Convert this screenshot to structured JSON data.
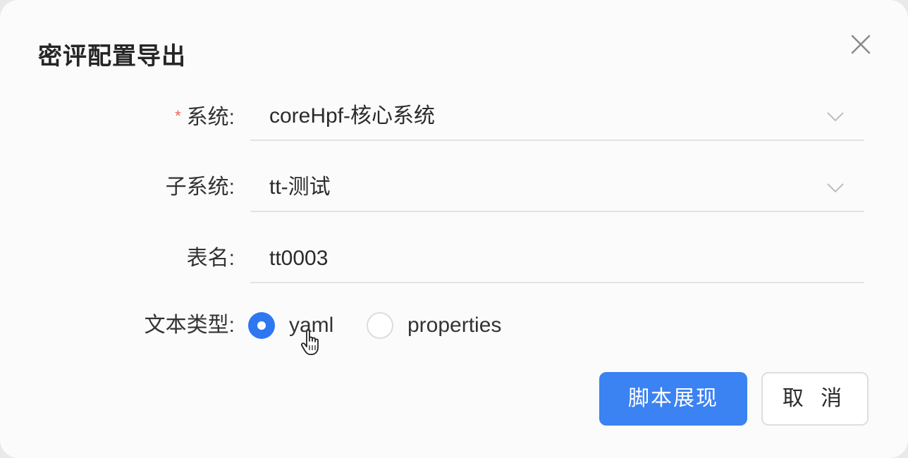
{
  "dialog": {
    "title": "密评配置导出",
    "close_icon": "close-icon"
  },
  "form": {
    "system": {
      "label": "系统:",
      "required_mark": "*",
      "value": "coreHpf-核心系统",
      "icon": "chevron-down-icon"
    },
    "subsystem": {
      "label": "子系统:",
      "value": "tt-测试",
      "icon": "chevron-down-icon"
    },
    "table_name": {
      "label": "表名:",
      "value": "tt0003"
    },
    "text_type": {
      "label": "文本类型:",
      "options": [
        {
          "label": "yaml",
          "checked": true
        },
        {
          "label": "properties",
          "checked": false
        }
      ]
    }
  },
  "footer": {
    "primary_label": "脚本展现",
    "cancel_label": "取 消"
  },
  "colors": {
    "accent": "#3b82f2",
    "required": "#f0625a"
  }
}
